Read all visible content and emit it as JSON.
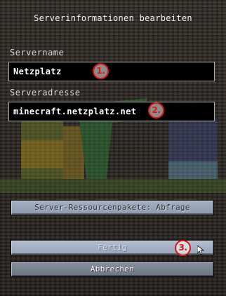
{
  "dialog": {
    "title": "Serverinformationen bearbeiten"
  },
  "server_name": {
    "label": "Servername",
    "value": "Netzplatz"
  },
  "server_address": {
    "label": "Serveradresse",
    "value": "minecraft.netzplatz.net"
  },
  "buttons": {
    "resource_packs": "Server-Ressourcenpakete: Abfrage",
    "done": "Fertig",
    "cancel": "Abbrechen"
  },
  "markers": [
    "1.",
    "2.",
    "3."
  ],
  "colors": {
    "marker_red": "#e01515",
    "field_background": "#000000",
    "button_blue": "#a4b0c4"
  }
}
